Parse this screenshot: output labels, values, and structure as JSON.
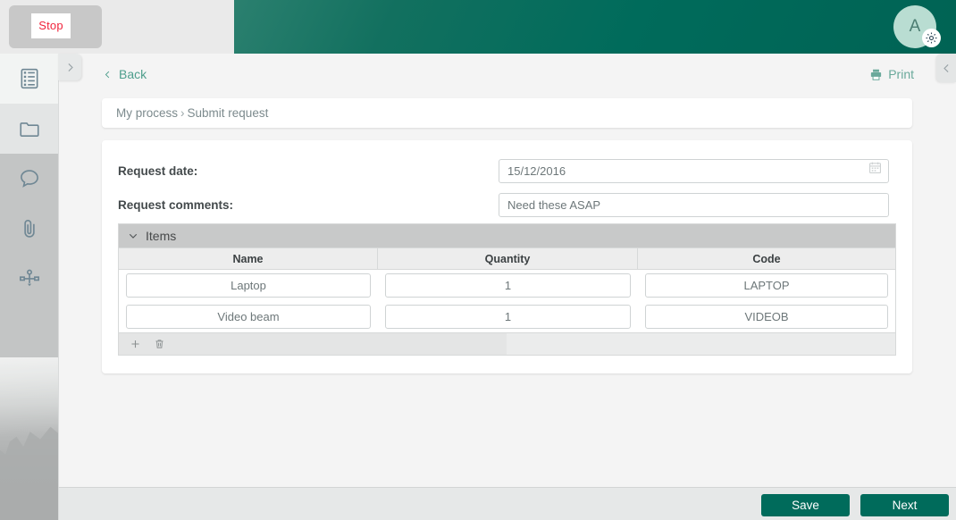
{
  "automation": {
    "stop_label": "Stop"
  },
  "header": {
    "avatar_initial": "A",
    "avatar_icon": "gear-icon",
    "brand_color": "#006b5b",
    "avatar_bg": "#b9ddd2"
  },
  "sidebar": {
    "items": [
      {
        "icon": "form-list-icon",
        "state": "active"
      },
      {
        "icon": "folder-icon",
        "state": "alt"
      },
      {
        "icon": "comment-bubble-icon",
        "state": "normal"
      },
      {
        "icon": "paperclip-icon",
        "state": "normal"
      },
      {
        "icon": "process-diagram-icon",
        "state": "normal"
      }
    ],
    "expand_icon": "chevron-right-icon"
  },
  "right_panel": {
    "collapse_icon": "chevron-left-icon"
  },
  "toolbar": {
    "back_label": "Back",
    "back_icon": "chevron-left-icon",
    "print_label": "Print",
    "print_icon": "printer-icon"
  },
  "breadcrumb": {
    "root": "My process",
    "separator": "›",
    "current": "Submit request"
  },
  "form": {
    "fields": [
      {
        "label": "Request date:",
        "value": "15/12/2016",
        "placeholder": "dd/mm/yyyy",
        "icon": "calendar-icon"
      },
      {
        "label": "Request comments:",
        "value": "Need these ASAP",
        "placeholder": "Enter comments"
      }
    ]
  },
  "items_grid": {
    "title": "Items",
    "collapse_icon": "chevron-down-icon",
    "columns": [
      "Name",
      "Quantity",
      "Code"
    ],
    "rows": [
      {
        "name": "Laptop",
        "quantity": "1",
        "code": "LAPTOP"
      },
      {
        "name": "Video beam",
        "quantity": "1",
        "code": "VIDEOB"
      }
    ],
    "actions": [
      {
        "icon": "plus-icon"
      },
      {
        "icon": "trash-icon"
      }
    ]
  },
  "footer": {
    "save_label": "Save",
    "next_label": "Next"
  }
}
